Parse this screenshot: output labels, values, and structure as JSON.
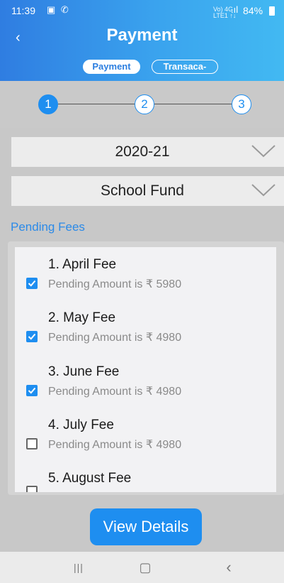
{
  "status_bar": {
    "time": "11:39",
    "notification_icons": "▣ ✆",
    "network": "Vo) 4G\nLTE1 ↑↓",
    "signal": ".ıl",
    "battery": "84%"
  },
  "header": {
    "back_icon": "chevron-left-icon",
    "back_glyph": "‹",
    "title": "Payment"
  },
  "tabs": [
    {
      "label": "Payment",
      "active": true
    },
    {
      "label": "Transaca-",
      "active": false
    }
  ],
  "stepper": {
    "steps": [
      "1",
      "2",
      "3"
    ],
    "current": 1
  },
  "dropdowns": [
    {
      "value": "2020-21"
    },
    {
      "value": "School Fund"
    }
  ],
  "section_label": "Pending Fees",
  "fees": [
    {
      "title": "1. April Fee",
      "subtitle": "Pending Amount is ₹ 5980",
      "checked": true
    },
    {
      "title": "2. May Fee",
      "subtitle": "Pending Amount is ₹ 4980",
      "checked": true
    },
    {
      "title": "3. June Fee",
      "subtitle": "Pending Amount is ₹ 4980",
      "checked": true
    },
    {
      "title": "4. July Fee",
      "subtitle": "Pending Amount is ₹ 4980",
      "checked": false
    },
    {
      "title": "5. August Fee",
      "subtitle": "",
      "checked": false
    }
  ],
  "view_button": {
    "label": "View Details"
  },
  "navbar": {
    "recent": "|||",
    "home": "▢",
    "back": "‹"
  },
  "colors": {
    "accent": "#1e8ef0",
    "header_start": "#2f7de1",
    "header_end": "#42b9f2"
  }
}
